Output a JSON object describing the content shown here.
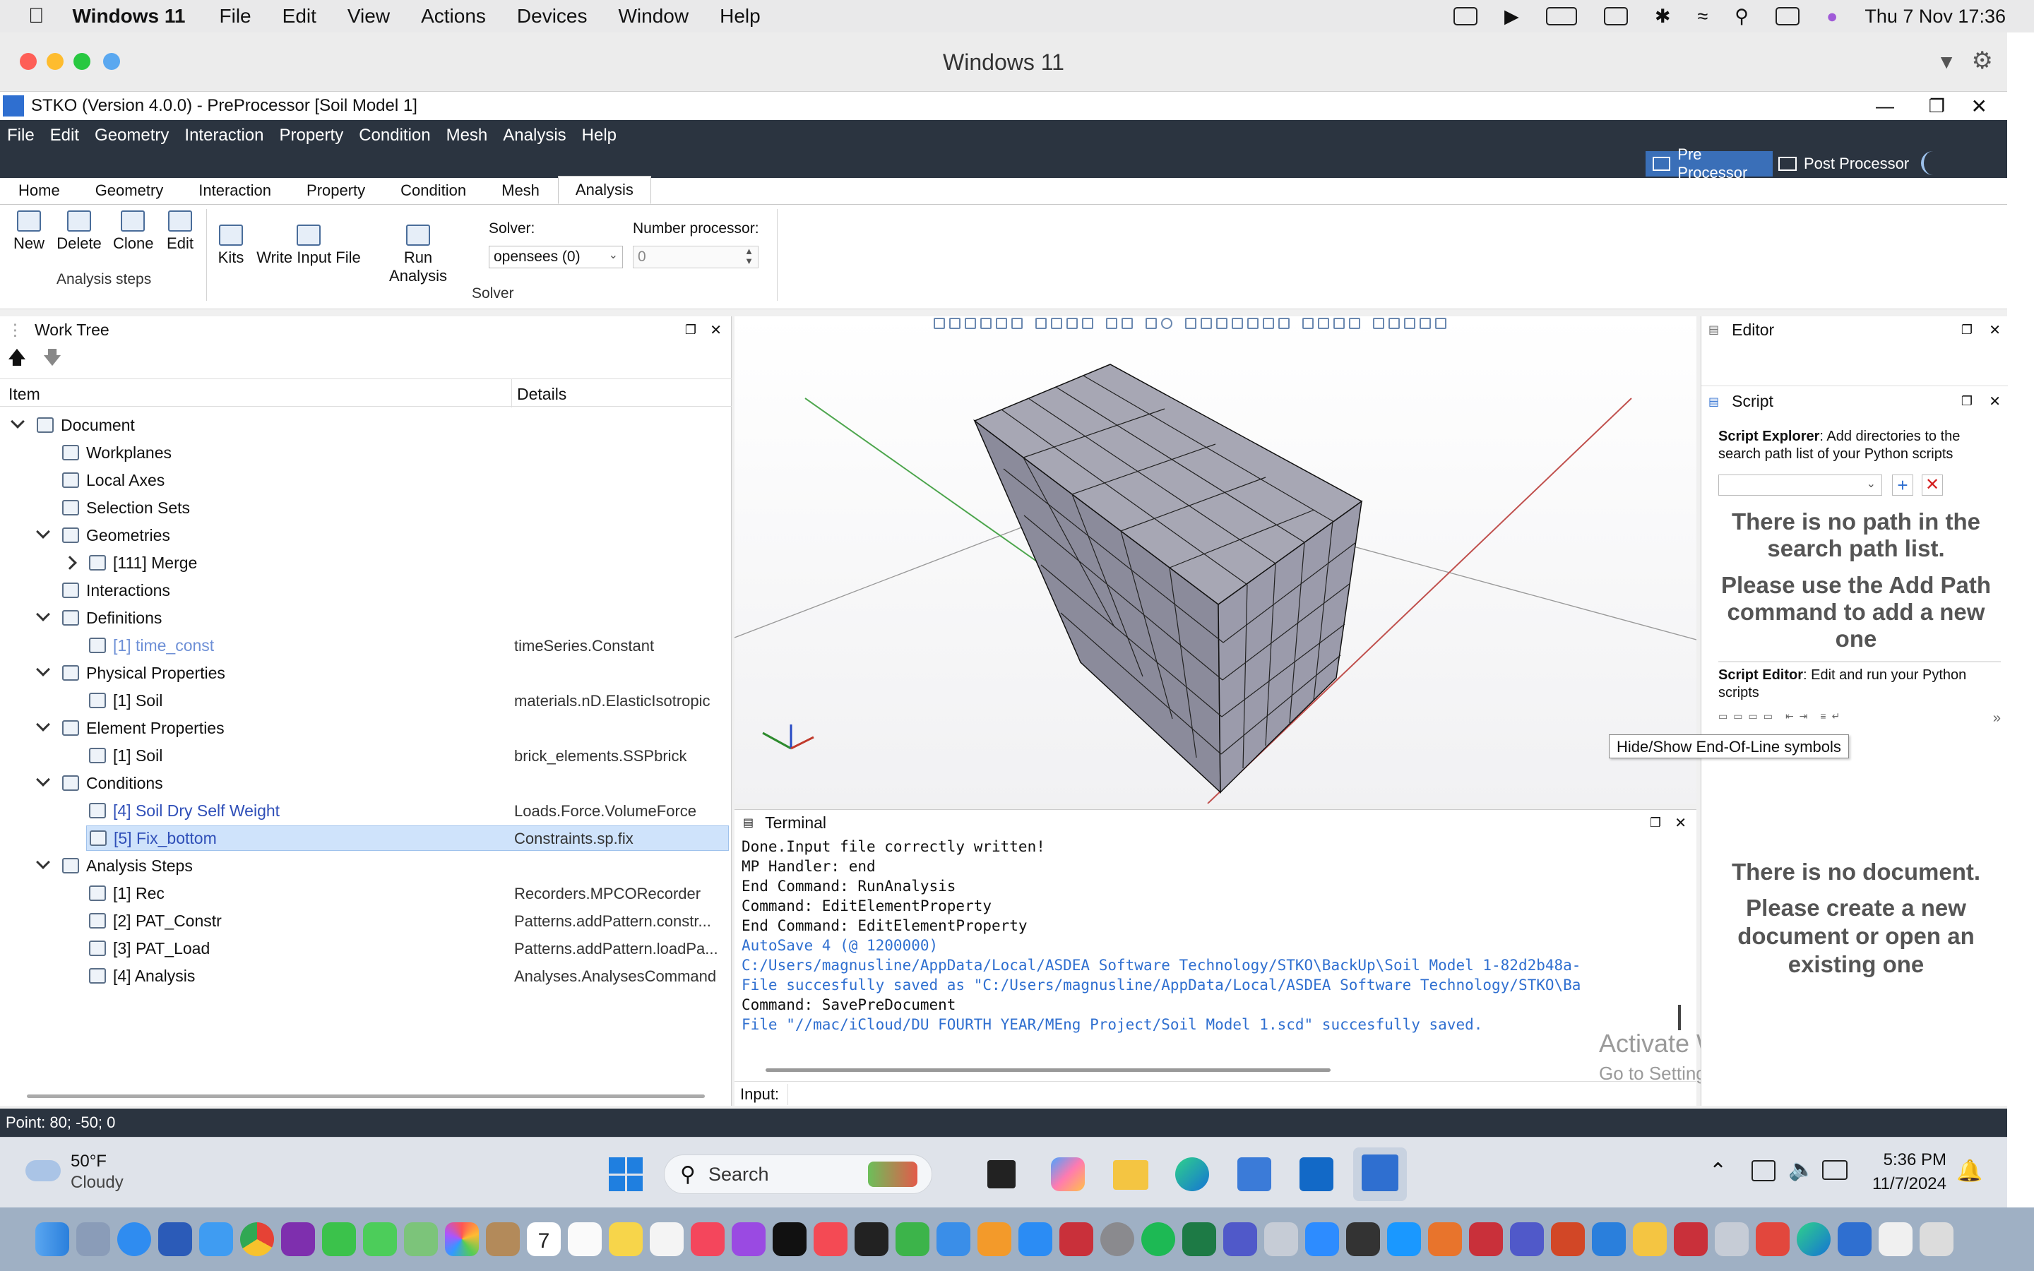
{
  "mac_menu": {
    "app_name": "Windows 11",
    "items": [
      "File",
      "Edit",
      "View",
      "Actions",
      "Devices",
      "Window",
      "Help"
    ],
    "clock": "Thu 7 Nov  17:36"
  },
  "window": {
    "title": "Windows 11"
  },
  "stko": {
    "title": "STKO (Version 4.0.0) - PreProcessor [Soil Model 1]",
    "menu": [
      "File",
      "Edit",
      "Geometry",
      "Interaction",
      "Property",
      "Condition",
      "Mesh",
      "Analysis",
      "Help"
    ],
    "pre_processor": "Pre Processor",
    "post_processor": "Post Processor",
    "tabs": [
      "Home",
      "Geometry",
      "Interaction",
      "Property",
      "Condition",
      "Mesh",
      "Analysis"
    ],
    "active_tab": "Analysis",
    "ribbon": {
      "new": "New",
      "delete": "Delete",
      "clone": "Clone",
      "edit": "Edit",
      "group1": "Analysis steps",
      "kits": "Kits",
      "write": "Write Input File",
      "run": "Run Analysis",
      "solver_label": "Solver:",
      "solver_value": "opensees (0)",
      "nproc_label": "Number processor:",
      "nproc_value": "0",
      "group2": "Solver"
    }
  },
  "worktree": {
    "title": "Work Tree",
    "col_item": "Item",
    "col_details": "Details",
    "rows": [
      {
        "label": "Document",
        "detail": ""
      },
      {
        "label": "Workplanes",
        "detail": ""
      },
      {
        "label": "Local Axes",
        "detail": ""
      },
      {
        "label": "Selection Sets",
        "detail": ""
      },
      {
        "label": "Geometries",
        "detail": ""
      },
      {
        "label": "[111] Merge",
        "detail": ""
      },
      {
        "label": "Interactions",
        "detail": ""
      },
      {
        "label": "Definitions",
        "detail": ""
      },
      {
        "label": "[1] time_const",
        "detail": "timeSeries.Constant"
      },
      {
        "label": "Physical Properties",
        "detail": ""
      },
      {
        "label": "[1] Soil",
        "detail": "materials.nD.ElasticIsotropic"
      },
      {
        "label": "Element Properties",
        "detail": ""
      },
      {
        "label": "[1] Soil",
        "detail": "brick_elements.SSPbrick"
      },
      {
        "label": "Conditions",
        "detail": ""
      },
      {
        "label": "[4] Soil Dry Self Weight",
        "detail": "Loads.Force.VolumeForce"
      },
      {
        "label": "[5] Fix_bottom",
        "detail": "Constraints.sp.fix"
      },
      {
        "label": "Analysis Steps",
        "detail": ""
      },
      {
        "label": "[1] Rec",
        "detail": "Recorders.MPCORecorder"
      },
      {
        "label": "[2] PAT_Constr",
        "detail": "Patterns.addPattern.constr..."
      },
      {
        "label": "[3] PAT_Load",
        "detail": "Patterns.addPattern.loadPa..."
      },
      {
        "label": "[4] Analysis",
        "detail": "Analyses.AnalysesCommand"
      }
    ]
  },
  "terminal": {
    "title": "Terminal",
    "lines": [
      "Done.Input file correctly written!",
      "MP Handler: end",
      "End Command: RunAnalysis",
      "Command: EditElementProperty",
      "End Command: EditElementProperty",
      "AutoSave 4 (@ 1200000)",
      "C:/Users/magnusline/AppData/Local/ASDEA Software Technology/STKO\\BackUp\\Soil Model 1-82d2b48a-",
      "File succesfully saved as \"C:/Users/magnusline/AppData/Local/ASDEA Software Technology/STKO\\Ba",
      "Command: SavePreDocument",
      "File \"//mac/iCloud/DU FOURTH YEAR/MEng Project/Soil Model 1.scd\" succesfully saved."
    ],
    "input_label": "Input:"
  },
  "editor": {
    "title": "Editor",
    "script_title": "Script",
    "explorer_bold": "Script Explorer",
    "explorer_text": ": Add directories to the search path list of your Python scripts",
    "no_path": "There is no path in the search path list.",
    "add_path": "Please use the Add Path command to add a new one",
    "script_editor_bold": "Script Editor",
    "script_editor_text": ": Edit and run your Python scripts",
    "tooltip": "Hide/Show End-Of-Line symbols",
    "no_doc": "There is no document.",
    "create_doc": "Please create a new document or open an existing one"
  },
  "watermark": {
    "line1": "Activate Windows",
    "line2": "Go to Settings to activate Windows."
  },
  "status": {
    "point": "Point: 80; -50; 0"
  },
  "taskbar": {
    "temp": "50°F",
    "weather": "Cloudy",
    "search": "Search",
    "time": "5:36 PM",
    "date": "11/7/2024"
  },
  "dock_badges": {
    "calendar_day": "7"
  },
  "colors": {
    "stko_dark": "#2b3440",
    "accent_blue": "#2f6fd0",
    "selection": "#cfe3fb",
    "mesh_face": "#8d8d9c"
  }
}
